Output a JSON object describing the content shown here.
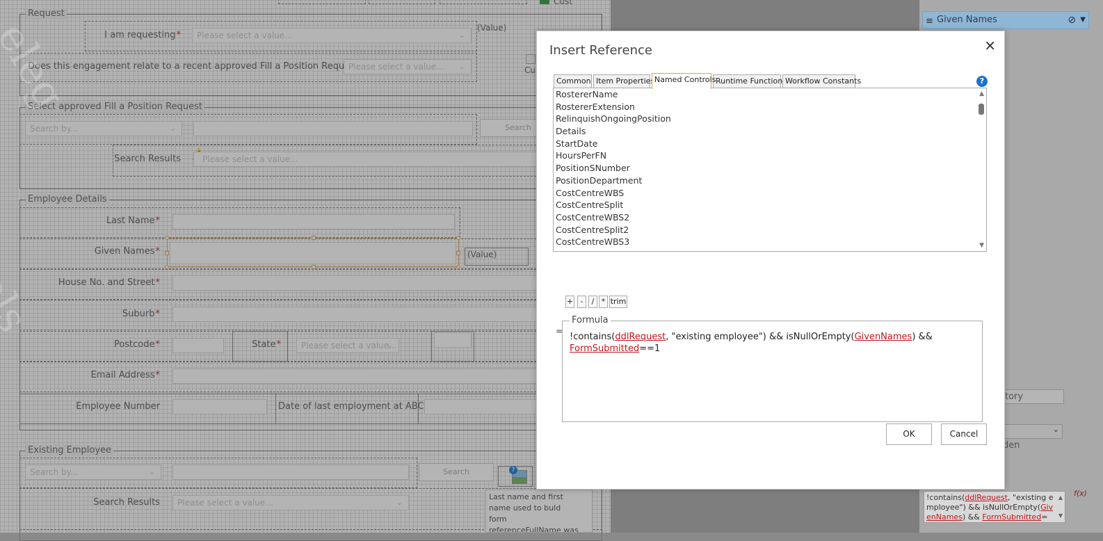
{
  "form": {
    "request": {
      "legend": "Request",
      "requesting_label": "I am requesting",
      "requesting_placeholder": "Please select a value...",
      "value_label": "(Value)",
      "engagement_label": "Does this engagement relate to a recent approved Fill a Position Request?",
      "engagement_placeholder": "Please select a value...",
      "partial_top_text": "Cust",
      "partial_image_text": "Cu"
    },
    "select_approved": {
      "legend": "Select approved Fill a Position Request",
      "search_by_placeholder": "Search by...",
      "search_button": "Search",
      "search_results_label": "Search Results",
      "search_results_placeholder": "Please select a value..."
    },
    "employee_details": {
      "legend": "Employee Details",
      "last_name_label": "Last Name",
      "given_names_label": "Given Names",
      "given_names_value": "(Value)",
      "house_label": "House No. and Street",
      "suburb_label": "Suburb",
      "postcode_label": "Postcode",
      "state_label": "State",
      "state_placeholder": "Please select a value...",
      "email_label": "Email Address",
      "employee_number_label": "Employee Number",
      "last_employment_label": "Date of last employment at ABC",
      "required_marker": "*"
    },
    "existing_employee": {
      "legend": "Existing Employee",
      "search_by_placeholder": "Search by...",
      "search_button": "Search",
      "search_results_label": "Search Results",
      "search_results_placeholder": "Please select a value...",
      "note_text": "Last name and first name used to buld form referenceFullName was"
    }
  },
  "properties": {
    "selected_item": "Given Names",
    "partial_mandatory": "atory",
    "partial_hidden": "den",
    "formula_parts": {
      "p1": "!contains(",
      "r1": "ddlRequest",
      "p2": ", \"existing e mployee\") && isNullOrEmpty(",
      "r2": "GivenNames",
      "p3": ") && ",
      "r3": "FormSubmitted",
      "p4": "=="
    },
    "fx_label": "f(x)"
  },
  "dialog": {
    "title": "Insert Reference",
    "close_glyph": "×",
    "tabs": [
      "Common",
      "Item Properties",
      "Named Controls",
      "Runtime Functions",
      "Workflow Constants"
    ],
    "active_tab": "Named Controls",
    "help_glyph": "?",
    "named_controls": [
      "RostererName",
      "RostererExtension",
      "RelinquishOngoingPosition",
      "Details",
      "StartDate",
      "HoursPerFN",
      "PositionSNumber",
      "PositionDepartment",
      "CostCentreWBS",
      "CostCentreSplit",
      "CostCentreWBS2",
      "CostCentreSplit2",
      "CostCentreWBS3"
    ],
    "operators": [
      "+",
      "-",
      "/",
      "*",
      "trim"
    ],
    "equals": "=",
    "formula_legend": "Formula",
    "formula": {
      "p1": "!contains(",
      "r1": "ddlRequest",
      "p2": ", \"existing employee\") && isNullOrEmpty(",
      "r2": "GivenNames",
      "p3": ") && ",
      "r3": "FormSubmitted",
      "p4": "==1"
    },
    "ok_label": "OK",
    "cancel_label": "Cancel"
  }
}
